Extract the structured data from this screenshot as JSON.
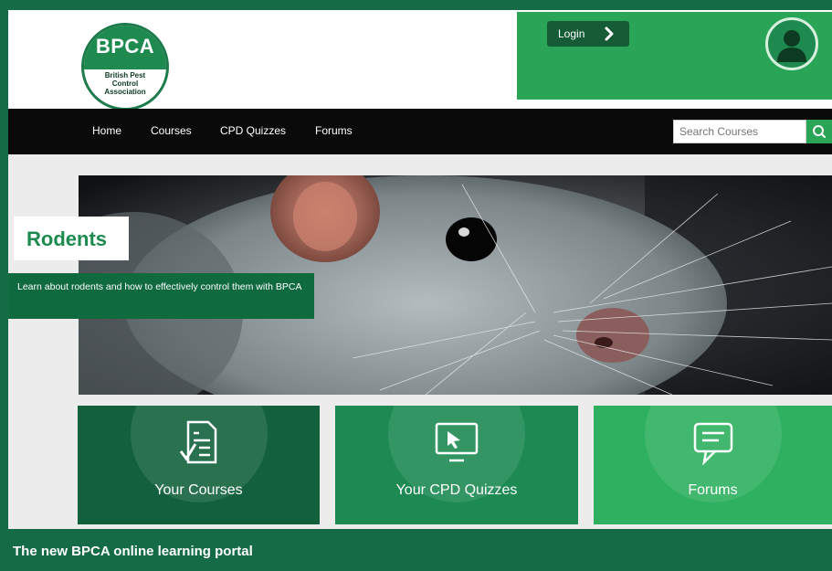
{
  "header": {
    "logo": {
      "abbr": "BPCA",
      "name_line1": "British Pest",
      "name_line2": "Control",
      "name_line3": "Association"
    },
    "login_label": "Login"
  },
  "nav": {
    "items": [
      "Home",
      "Courses",
      "CPD Quizzes",
      "Forums"
    ],
    "search_placeholder": "Search Courses"
  },
  "hero": {
    "title": "Rodents",
    "description": "Learn about rodents and how to effectively control them with BPCA"
  },
  "tiles": [
    {
      "label": "Your Courses",
      "icon": "document-check-icon",
      "color": "#12613c"
    },
    {
      "label": "Your CPD Quizzes",
      "icon": "monitor-cursor-icon",
      "color": "#1c8a52"
    },
    {
      "label": "Forums",
      "icon": "speech-bubble-icon",
      "color": "#2db05f"
    }
  ],
  "caption": "The new BPCA online learning portal",
  "colors": {
    "brand_green": "#1e8a4f",
    "dark_green": "#156b46",
    "accent_green": "#2aa456",
    "nav_black": "#0a0a0a"
  }
}
